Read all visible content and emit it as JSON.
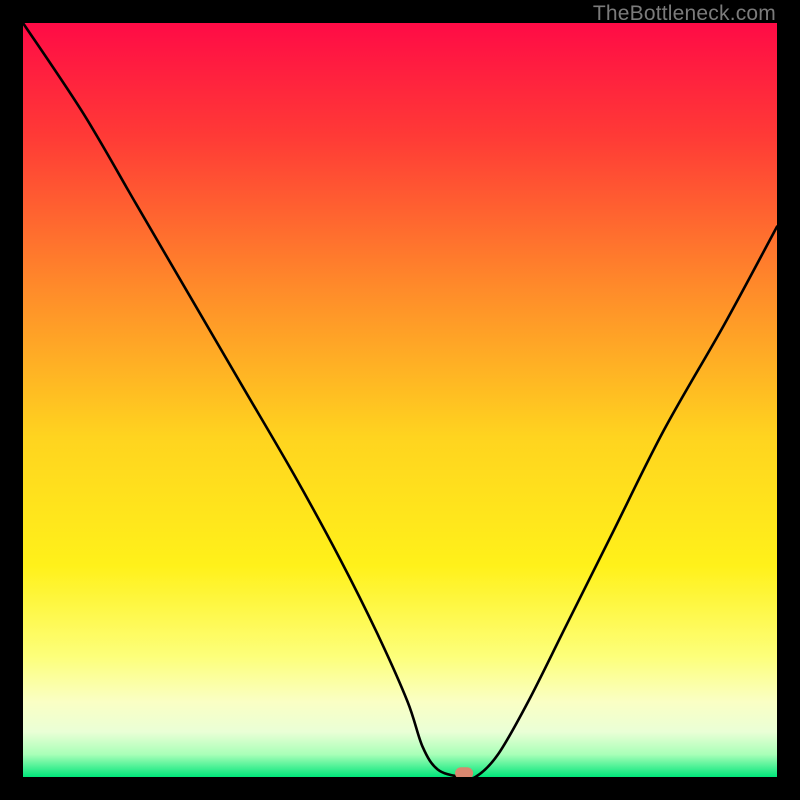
{
  "watermark": "TheBottleneck.com",
  "chart_data": {
    "type": "line",
    "title": "",
    "xlabel": "",
    "ylabel": "",
    "xlim": [
      0,
      100
    ],
    "ylim": [
      0,
      100
    ],
    "background": {
      "style": "vertical-gradient",
      "stops": [
        {
          "pos": 0.0,
          "color": "#ff0b46"
        },
        {
          "pos": 0.15,
          "color": "#ff3a36"
        },
        {
          "pos": 0.35,
          "color": "#ff8a2a"
        },
        {
          "pos": 0.55,
          "color": "#ffd41f"
        },
        {
          "pos": 0.72,
          "color": "#fff11a"
        },
        {
          "pos": 0.84,
          "color": "#fdff7a"
        },
        {
          "pos": 0.9,
          "color": "#faffc4"
        },
        {
          "pos": 0.94,
          "color": "#eaffd6"
        },
        {
          "pos": 0.97,
          "color": "#a9ffb8"
        },
        {
          "pos": 1.0,
          "color": "#00e67a"
        }
      ]
    },
    "series": [
      {
        "name": "bottleneck-curve",
        "color": "#000000",
        "stroke_width": 2.6,
        "x": [
          0,
          8,
          15,
          22,
          29,
          36,
          42,
          47,
          51,
          53,
          55,
          58,
          60,
          63,
          67,
          72,
          78,
          85,
          93,
          100
        ],
        "values": [
          100,
          88,
          76,
          64,
          52,
          40,
          29,
          19,
          10,
          4,
          1,
          0,
          0,
          3,
          10,
          20,
          32,
          46,
          60,
          73
        ]
      }
    ],
    "markers": [
      {
        "name": "optimum-marker",
        "x": 58.5,
        "y": 0.5,
        "shape": "rounded-rect",
        "color": "#d8876f",
        "width_pct": 2.4,
        "height_pct": 1.6
      }
    ]
  }
}
